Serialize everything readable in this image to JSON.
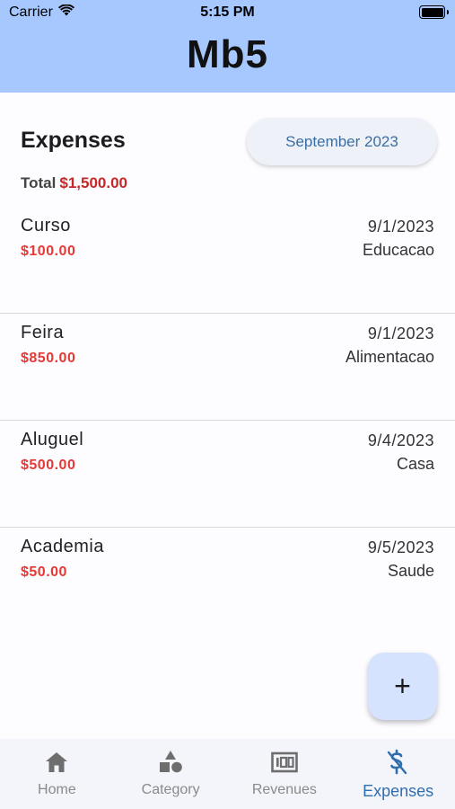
{
  "status_bar": {
    "carrier": "Carrier",
    "time": "5:15 PM"
  },
  "app": {
    "title": "Mb5"
  },
  "expenses": {
    "title": "Expenses",
    "month_label": "September 2023",
    "total_label": "Total",
    "total_value": "$1,500.00",
    "items": [
      {
        "name": "Curso",
        "amount": "$100.00",
        "date": "9/1/2023",
        "category": "Educacao"
      },
      {
        "name": "Feira",
        "amount": "$850.00",
        "date": "9/1/2023",
        "category": "Alimentacao"
      },
      {
        "name": "Aluguel",
        "amount": "$500.00",
        "date": "9/4/2023",
        "category": "Casa"
      },
      {
        "name": "Academia",
        "amount": "$50.00",
        "date": "9/5/2023",
        "category": "Saude"
      }
    ]
  },
  "fab": {
    "icon": "plus-icon",
    "label": "+"
  },
  "bottom_nav": {
    "items": [
      {
        "label": "Home",
        "icon": "home-icon",
        "active": false
      },
      {
        "label": "Category",
        "icon": "category-icon",
        "active": false
      },
      {
        "label": "Revenues",
        "icon": "money-icon",
        "active": false
      },
      {
        "label": "Expenses",
        "icon": "price-change-icon",
        "active": true
      }
    ]
  },
  "colors": {
    "header": "#a6c8ff",
    "accent": "#2f6ead",
    "amount_red": "#e53935",
    "total_red": "#c62828",
    "fab": "#d6e3ff"
  }
}
